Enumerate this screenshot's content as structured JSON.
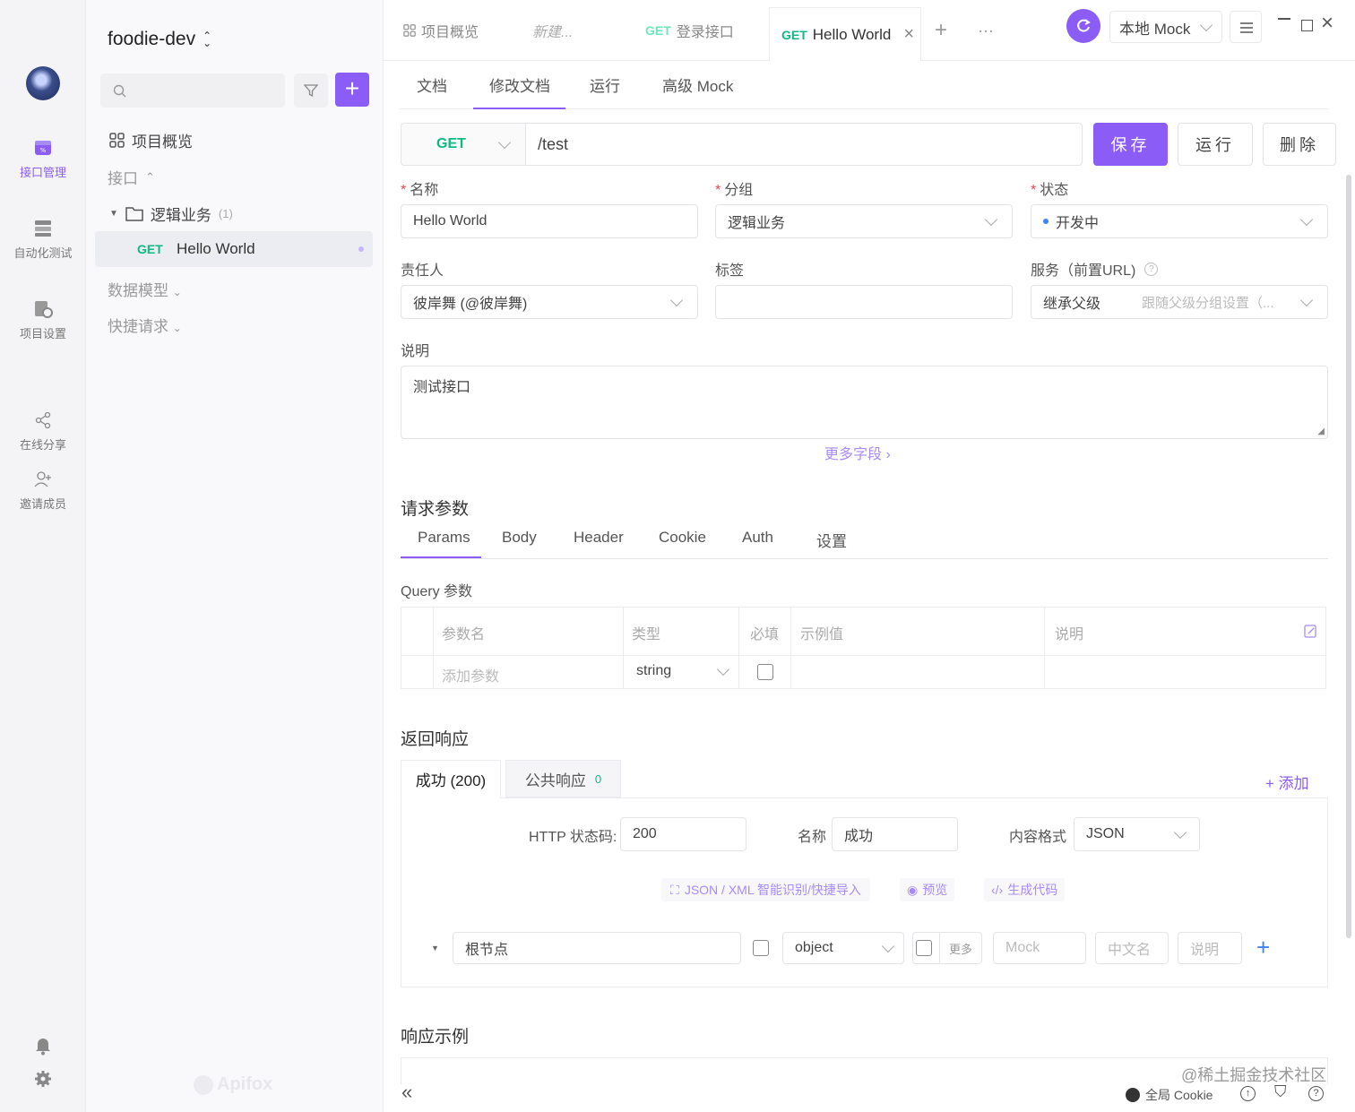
{
  "rail": {
    "items": [
      {
        "label": "接口管理"
      },
      {
        "label": "自动化测试"
      },
      {
        "label": "项目设置"
      },
      {
        "label": "在线分享"
      },
      {
        "label": "邀请成员"
      }
    ]
  },
  "sidebar": {
    "project_name": "foodie-dev",
    "overview": "项目概览",
    "interfaces": "接口",
    "folder": "逻辑业务",
    "folder_count": "(1)",
    "endpoint_method": "GET",
    "endpoint_name": "Hello World",
    "data_models": "数据模型",
    "quick_requests": "快捷请求",
    "brand": "Apifox"
  },
  "tabs": [
    {
      "label": "项目概览"
    },
    {
      "label": "新建..."
    },
    {
      "method": "GET",
      "label": "登录接口"
    },
    {
      "method": "GET",
      "label": "Hello World"
    }
  ],
  "env": {
    "label": "本地 Mock"
  },
  "doc_tabs": [
    "文档",
    "修改文档",
    "运行",
    "高级 Mock"
  ],
  "request": {
    "method": "GET",
    "path": "/test",
    "save": "保存",
    "run": "运行",
    "delete": "删除"
  },
  "form": {
    "name_label": "名称",
    "name_value": "Hello World",
    "group_label": "分组",
    "group_value": "逻辑业务",
    "status_label": "状态",
    "status_value": "开发中",
    "owner_label": "责任人",
    "owner_value": "彼岸舞 (@彼岸舞)",
    "tags_label": "标签",
    "service_label": "服务（前置URL)",
    "service_value": "继承父级",
    "service_hint": "跟随父级分组设置（...",
    "desc_label": "说明",
    "desc_value": "测试接口",
    "more_fields": "更多字段"
  },
  "params": {
    "title": "请求参数",
    "tabs": [
      "Params",
      "Body",
      "Header",
      "Cookie",
      "Auth",
      "设置"
    ],
    "query_title": "Query 参数",
    "headers": [
      "参数名",
      "类型",
      "必填",
      "示例值",
      "说明"
    ],
    "add_placeholder": "添加参数",
    "type_value": "string"
  },
  "response": {
    "title": "返回响应",
    "tab_success": "成功 (200)",
    "tab_common": "公共响应",
    "tab_common_count": "0",
    "add": "+ 添加",
    "status_code_label": "HTTP 状态码:",
    "status_code": "200",
    "name_label": "名称",
    "name_value": "成功",
    "format_label": "内容格式",
    "format_value": "JSON",
    "tool_import": "JSON / XML 智能识别/快捷导入",
    "tool_preview": "预览",
    "tool_code": "生成代码",
    "root_node": "根节点",
    "root_type": "object",
    "more": "更多",
    "mock_ph": "Mock",
    "cn_name_ph": "中文名",
    "desc_ph": "说明",
    "example_title": "响应示例"
  },
  "footer": {
    "cookie": "全局 Cookie",
    "watermark": "@稀土掘金技术社区"
  },
  "colors": {
    "accent": "#8b5cf6",
    "get": "#10b981"
  }
}
